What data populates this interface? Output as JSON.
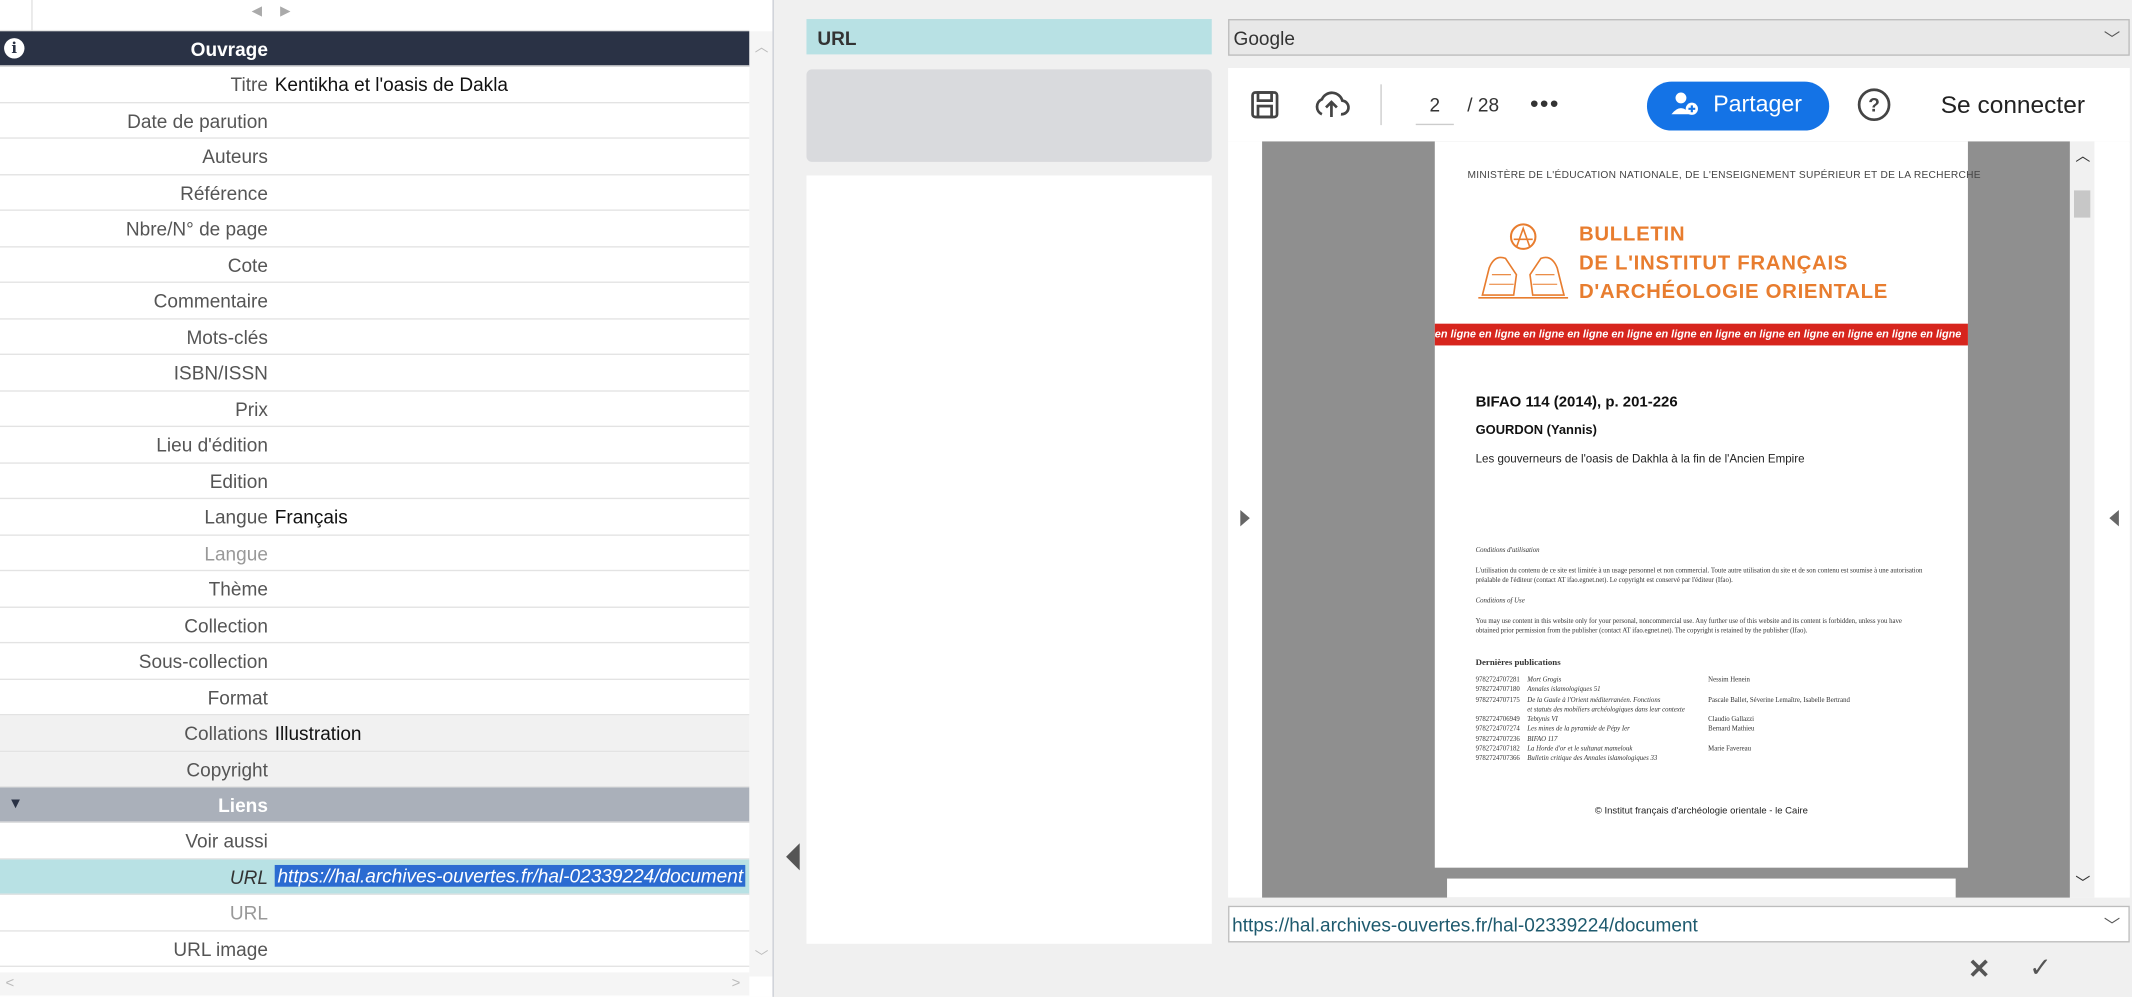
{
  "form": {
    "section_ouvrage": "Ouvrage",
    "section_liens": "Liens",
    "rows": [
      {
        "label": "Titre",
        "value": "Kentikha et l'oasis de Dakla"
      },
      {
        "label": "Date de parution",
        "value": ""
      },
      {
        "label": "Auteurs",
        "value": ""
      },
      {
        "label": "Référence",
        "value": ""
      },
      {
        "label": "Nbre/N° de page",
        "value": ""
      },
      {
        "label": "Cote",
        "value": ""
      },
      {
        "label": "Commentaire",
        "value": ""
      },
      {
        "label": "Mots-clés",
        "value": ""
      },
      {
        "label": "ISBN/ISSN",
        "value": ""
      },
      {
        "label": "Prix",
        "value": ""
      },
      {
        "label": "Lieu d'édition",
        "value": ""
      },
      {
        "label": "Edition",
        "value": ""
      },
      {
        "label": "Langue",
        "value": "Français"
      },
      {
        "label": "Langue",
        "value": ""
      },
      {
        "label": "Thème",
        "value": ""
      },
      {
        "label": "Collection",
        "value": ""
      },
      {
        "label": "Sous-collection",
        "value": ""
      },
      {
        "label": "Format",
        "value": ""
      },
      {
        "label": "Collations",
        "value": "Illustration"
      },
      {
        "label": "Copyright",
        "value": ""
      }
    ],
    "links": [
      {
        "label": "Voir aussi",
        "value": ""
      },
      {
        "label": "URL",
        "value": "https://hal.archives-ouvertes.fr/hal-02339224/document"
      },
      {
        "label": "URL",
        "value": ""
      },
      {
        "label": "URL image",
        "value": ""
      }
    ]
  },
  "middle": {
    "field_label": "URL"
  },
  "viewer": {
    "engine": "Google",
    "page_current": "2",
    "page_total": "/ 28",
    "share_label": "Partager",
    "connect_label": "Se connecter",
    "url_value": "https://hal.archives-ouvertes.fr/hal-02339224/document",
    "doc": {
      "ministry": "MINISTÈRE DE L'ÉDUCATION NATIONALE, DE L'ENSEIGNEMENT SUPÉRIEUR ET DE LA RECHERCHE",
      "bulletin_1": "BULLETIN",
      "bulletin_2": "DE L'INSTITUT FRANÇAIS",
      "bulletin_3": "D'ARCHÉOLOGIE ORIENTALE",
      "band": "en ligne en ligne en ligne en ligne en ligne en ligne en ligne en ligne en ligne en ligne en ligne en ligne",
      "ref": "BIFAO 114 (2014), p. 201-226",
      "author": "GOURDON (Yannis)",
      "title": "Les gouverneurs de l'oasis de Dakhla à la fin de l'Ancien Empire",
      "cond_fr_h": "Conditions d'utilisation",
      "cond_fr": "L'utilisation du contenu de ce site est limitée à un usage personnel et non commercial. Toute autre utilisation du site et de son contenu est soumise à une autorisation préalable de l'éditeur (contact AT ifao.egnet.net). Le copyright est conservé par l'éditeur (Ifao).",
      "cond_en_h": "Conditions of Use",
      "cond_en": "You may use content in this website only for your personal, noncommercial use. Any further use of this website and its content is forbidden, unless you have obtained prior permission from the publisher (contact AT ifao.egnet.net). The copyright is retained by the publisher (Ifao).",
      "pubs_h": "Dernières publications",
      "pubs": [
        {
          "isbn": "9782724707281",
          "title": "Mort Grogis",
          "author": "Nessim Henein"
        },
        {
          "isbn": "9782724707180",
          "title": "Annales islamologiques 51",
          "author": ""
        },
        {
          "isbn": "9782724707175",
          "title": "De la Gaule à l'Orient méditerranéen. Fonctions",
          "author": "Pascale Ballet, Séverine Lemaître, Isabelle Bertrand"
        },
        {
          "isbn": "",
          "title": "et statuts des mobiliers archéologiques dans leur contexte",
          "author": ""
        },
        {
          "isbn": "9782724706949",
          "title": "Tebtynis VI",
          "author": "Claudio Gallazzi"
        },
        {
          "isbn": "9782724707274",
          "title": "Les mines de la pyramide de Pépy Ier",
          "author": "Bernard Mathieu"
        },
        {
          "isbn": "9782724707236",
          "title": "BIFAO 117",
          "author": ""
        },
        {
          "isbn": "9782724707182",
          "title": "La Horde d'or et le sultanat mamelouk",
          "author": "Marie Favereau"
        },
        {
          "isbn": "9782724707366",
          "title": "Bulletin critique des Annales islamologiques 33",
          "author": ""
        }
      ],
      "copyright": "© Institut français d'archéologie orientale - le Caire"
    }
  }
}
